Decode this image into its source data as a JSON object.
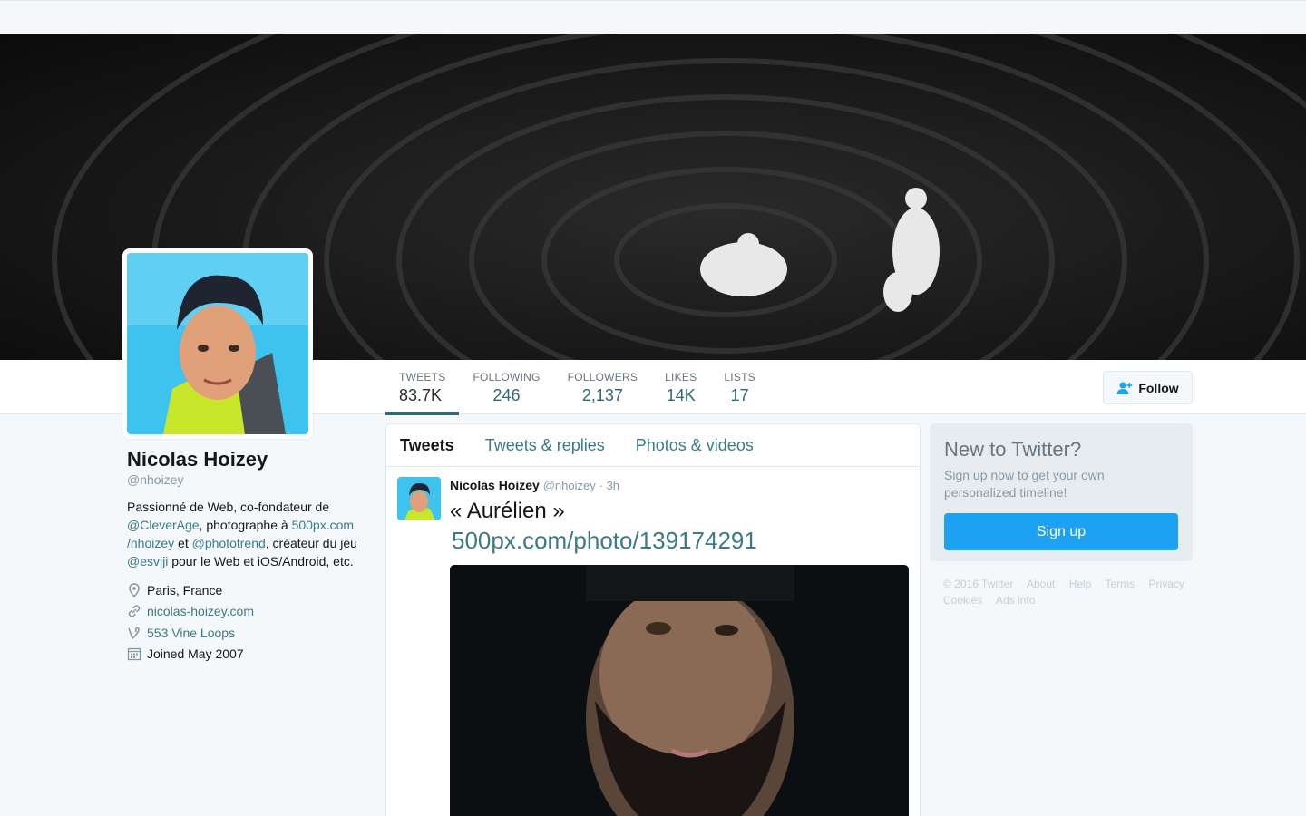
{
  "profile": {
    "name": "Nicolas Hoizey",
    "handle": "@nhoizey",
    "bio": {
      "t1": "Passionné de Web, co-fondateur de ",
      "cleverage": "@CleverAge",
      "t2": ", photographe à ",
      "px500": "500px.com",
      "px500_cont": "/nhoizey",
      "t3": " et ",
      "phototrend": "@phototrend",
      "t4": ", créateur du jeu ",
      "esviji": "@esviji",
      "t5": " pour le Web et iOS/Android, etc."
    },
    "location": "Paris, France",
    "website": "nicolas-hoizey.com",
    "vine": "553 Vine Loops",
    "joined": "Joined May 2007"
  },
  "stats": [
    {
      "label": "Tweets",
      "value": "83.7K"
    },
    {
      "label": "Following",
      "value": "246"
    },
    {
      "label": "Followers",
      "value": "2,137"
    },
    {
      "label": "Likes",
      "value": "14K"
    },
    {
      "label": "Lists",
      "value": "17"
    }
  ],
  "follow_label": "Follow",
  "timeline": {
    "tabs": [
      "Tweets",
      "Tweets & replies",
      "Photos & videos"
    ],
    "tweet": {
      "name": "Nicolas Hoizey",
      "handle": "@nhoizey",
      "time": "· 3h",
      "text": "« Aurélien »",
      "link": "500px.com/photo/139174291"
    }
  },
  "signup": {
    "title": "New to Twitter?",
    "subtitle": "Sign up now to get your own personalized timeline!",
    "button": "Sign up"
  },
  "footer": [
    "© 2016 Twitter",
    "About",
    "Help",
    "Terms",
    "Privacy",
    "Cookies",
    "Ads info"
  ],
  "colors": {
    "accent": "#2f6a73",
    "link": "#3b7a87",
    "signup_button": "#1da1f2"
  },
  "icons": {
    "location": "location-pin-icon",
    "website": "link-icon",
    "vine": "vine-icon",
    "joined": "calendar-icon",
    "follow": "add-user-icon"
  }
}
